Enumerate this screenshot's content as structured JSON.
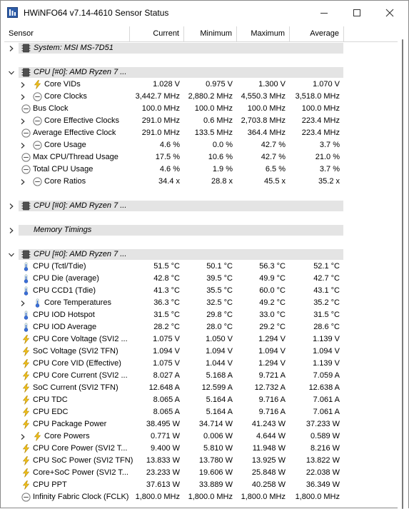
{
  "window": {
    "title": "HWiNFO64 v7.14-4610 Sensor Status"
  },
  "columns": {
    "sensor": "Sensor",
    "current": "Current",
    "minimum": "Minimum",
    "maximum": "Maximum",
    "average": "Average"
  },
  "rows": [
    {
      "type": "group",
      "state": "collapsed",
      "icon": "chip",
      "label": "System: MSI MS-7D51"
    },
    {
      "type": "spacer"
    },
    {
      "type": "group",
      "state": "expanded",
      "icon": "chip",
      "label": "CPU [#0]: AMD Ryzen 7 ..."
    },
    {
      "type": "item",
      "indent": 1,
      "expander": "collapsed",
      "icon": "bolt",
      "label": "Core VIDs",
      "cur": "1.028 V",
      "min": "0.975 V",
      "max": "1.300 V",
      "avg": "1.070 V"
    },
    {
      "type": "item",
      "indent": 1,
      "expander": "collapsed",
      "icon": "clock",
      "label": "Core Clocks",
      "cur": "3,442.7 MHz",
      "min": "2,880.2 MHz",
      "max": "4,550.3 MHz",
      "avg": "3,518.0 MHz"
    },
    {
      "type": "item",
      "indent": 0,
      "icon": "clock",
      "label": "Bus Clock",
      "cur": "100.0 MHz",
      "min": "100.0 MHz",
      "max": "100.0 MHz",
      "avg": "100.0 MHz"
    },
    {
      "type": "item",
      "indent": 1,
      "expander": "collapsed",
      "icon": "clock",
      "label": "Core Effective Clocks",
      "cur": "291.0 MHz",
      "min": "0.6 MHz",
      "max": "2,703.8 MHz",
      "avg": "223.4 MHz"
    },
    {
      "type": "item",
      "indent": 0,
      "icon": "clock",
      "label": "Average Effective Clock",
      "cur": "291.0 MHz",
      "min": "133.5 MHz",
      "max": "364.4 MHz",
      "avg": "223.4 MHz"
    },
    {
      "type": "item",
      "indent": 1,
      "expander": "collapsed",
      "icon": "clock",
      "label": "Core Usage",
      "cur": "4.6 %",
      "min": "0.0 %",
      "max": "42.7 %",
      "avg": "3.7 %"
    },
    {
      "type": "item",
      "indent": 0,
      "icon": "clock",
      "label": "Max CPU/Thread Usage",
      "cur": "17.5 %",
      "min": "10.6 %",
      "max": "42.7 %",
      "avg": "21.0 %"
    },
    {
      "type": "item",
      "indent": 0,
      "icon": "clock",
      "label": "Total CPU Usage",
      "cur": "4.6 %",
      "min": "1.9 %",
      "max": "6.5 %",
      "avg": "3.7 %"
    },
    {
      "type": "item",
      "indent": 1,
      "expander": "collapsed",
      "icon": "clock",
      "label": "Core Ratios",
      "cur": "34.4 x",
      "min": "28.8 x",
      "max": "45.5 x",
      "avg": "35.2 x"
    },
    {
      "type": "spacer"
    },
    {
      "type": "group",
      "state": "collapsed",
      "icon": "chip",
      "label": "CPU [#0]: AMD Ryzen 7 ..."
    },
    {
      "type": "spacer"
    },
    {
      "type": "group",
      "state": "collapsed",
      "icon": "none",
      "label": "Memory Timings"
    },
    {
      "type": "spacer"
    },
    {
      "type": "group",
      "state": "expanded",
      "icon": "chip",
      "label": "CPU [#0]: AMD Ryzen 7 ..."
    },
    {
      "type": "item",
      "indent": 0,
      "icon": "therm",
      "label": "CPU (Tctl/Tdie)",
      "cur": "51.5 °C",
      "min": "50.1 °C",
      "max": "56.3 °C",
      "avg": "52.1 °C"
    },
    {
      "type": "item",
      "indent": 0,
      "icon": "therm",
      "label": "CPU Die (average)",
      "cur": "42.8 °C",
      "min": "39.5 °C",
      "max": "49.9 °C",
      "avg": "42.7 °C"
    },
    {
      "type": "item",
      "indent": 0,
      "icon": "therm",
      "label": "CPU CCD1 (Tdie)",
      "cur": "41.3 °C",
      "min": "35.5 °C",
      "max": "60.0 °C",
      "avg": "43.1 °C"
    },
    {
      "type": "item",
      "indent": 1,
      "expander": "collapsed",
      "icon": "therm",
      "label": "Core Temperatures",
      "cur": "36.3 °C",
      "min": "32.5 °C",
      "max": "49.2 °C",
      "avg": "35.2 °C"
    },
    {
      "type": "item",
      "indent": 0,
      "icon": "therm",
      "label": "CPU IOD Hotspot",
      "cur": "31.5 °C",
      "min": "29.8 °C",
      "max": "33.0 °C",
      "avg": "31.5 °C"
    },
    {
      "type": "item",
      "indent": 0,
      "icon": "therm",
      "label": "CPU IOD Average",
      "cur": "28.2 °C",
      "min": "28.0 °C",
      "max": "29.2 °C",
      "avg": "28.6 °C"
    },
    {
      "type": "item",
      "indent": 0,
      "icon": "bolt",
      "label": "CPU Core Voltage (SVI2 ...",
      "cur": "1.075 V",
      "min": "1.050 V",
      "max": "1.294 V",
      "avg": "1.139 V"
    },
    {
      "type": "item",
      "indent": 0,
      "icon": "bolt",
      "label": "SoC Voltage (SVI2 TFN)",
      "cur": "1.094 V",
      "min": "1.094 V",
      "max": "1.094 V",
      "avg": "1.094 V"
    },
    {
      "type": "item",
      "indent": 0,
      "icon": "bolt",
      "label": "CPU Core VID (Effective)",
      "cur": "1.075 V",
      "min": "1.044 V",
      "max": "1.294 V",
      "avg": "1.139 V"
    },
    {
      "type": "item",
      "indent": 0,
      "icon": "bolt",
      "label": "CPU Core Current (SVI2 ...",
      "cur": "8.027 A",
      "min": "5.168 A",
      "max": "9.721 A",
      "avg": "7.059 A"
    },
    {
      "type": "item",
      "indent": 0,
      "icon": "bolt",
      "label": "SoC Current (SVI2 TFN)",
      "cur": "12.648 A",
      "min": "12.599 A",
      "max": "12.732 A",
      "avg": "12.638 A"
    },
    {
      "type": "item",
      "indent": 0,
      "icon": "bolt",
      "label": "CPU TDC",
      "cur": "8.065 A",
      "min": "5.164 A",
      "max": "9.716 A",
      "avg": "7.061 A"
    },
    {
      "type": "item",
      "indent": 0,
      "icon": "bolt",
      "label": "CPU EDC",
      "cur": "8.065 A",
      "min": "5.164 A",
      "max": "9.716 A",
      "avg": "7.061 A"
    },
    {
      "type": "item",
      "indent": 0,
      "icon": "bolt",
      "label": "CPU Package Power",
      "cur": "38.495 W",
      "min": "34.714 W",
      "max": "41.243 W",
      "avg": "37.233 W"
    },
    {
      "type": "item",
      "indent": 1,
      "expander": "collapsed",
      "icon": "bolt",
      "label": "Core Powers",
      "cur": "0.771 W",
      "min": "0.006 W",
      "max": "4.644 W",
      "avg": "0.589 W"
    },
    {
      "type": "item",
      "indent": 0,
      "icon": "bolt",
      "label": "CPU Core Power (SVI2 T...",
      "cur": "9.400 W",
      "min": "5.810 W",
      "max": "11.948 W",
      "avg": "8.216 W"
    },
    {
      "type": "item",
      "indent": 0,
      "icon": "bolt",
      "label": "CPU SoC Power (SVI2 TFN)",
      "cur": "13.833 W",
      "min": "13.780 W",
      "max": "13.925 W",
      "avg": "13.822 W"
    },
    {
      "type": "item",
      "indent": 0,
      "icon": "bolt",
      "label": "Core+SoC Power (SVI2 T...",
      "cur": "23.233 W",
      "min": "19.606 W",
      "max": "25.848 W",
      "avg": "22.038 W"
    },
    {
      "type": "item",
      "indent": 0,
      "icon": "bolt",
      "label": "CPU PPT",
      "cur": "37.613 W",
      "min": "33.889 W",
      "max": "40.258 W",
      "avg": "36.349 W"
    },
    {
      "type": "item",
      "indent": 0,
      "icon": "clock",
      "label": "Infinity Fabric Clock (FCLK)",
      "cur": "1,800.0 MHz",
      "min": "1,800.0 MHz",
      "max": "1,800.0 MHz",
      "avg": "1,800.0 MHz"
    }
  ],
  "colors": {
    "group_bg": "#e4e4e4",
    "bolt": "#f2c21b",
    "therm": "#3a6fd8",
    "chip": "#505050"
  }
}
